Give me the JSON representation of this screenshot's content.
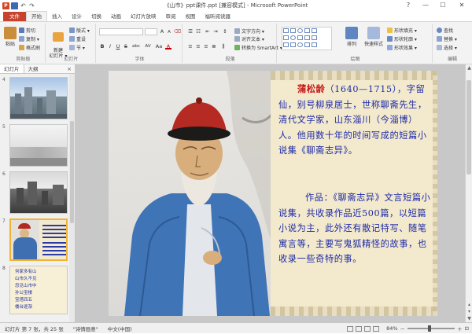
{
  "window": {
    "title": "《山市》ppt课件.ppt [兼容模式] - Microsoft PowerPoint",
    "app_icon_letter": "P"
  },
  "ribbon_tabs": [
    "文件",
    "开始",
    "插入",
    "设计",
    "切换",
    "动画",
    "幻灯片放映",
    "审阅",
    "视图",
    "福昕阅读器"
  ],
  "ribbon": {
    "clipboard": {
      "paste": "粘贴",
      "cut": "剪切",
      "copy": "复制 ▾",
      "format_painter": "格式刷",
      "label": "剪贴板"
    },
    "slides": {
      "new_slide": "新建\n幻灯片 ▾",
      "layout": "版式 ▾",
      "reset": "重设",
      "section": "节 ▾",
      "label": "幻灯片"
    },
    "font": {
      "label": "字体",
      "bold": "B",
      "italic": "I",
      "underline": "U",
      "strike": "S",
      "shadow": "abc",
      "spacing": "AV",
      "case": "Aa",
      "color": "A",
      "grow": "A",
      "shrink": "A"
    },
    "paragraph": {
      "label": "段落",
      "text_direction": "文字方向 ▾",
      "align_text": "对齐文本 ▾",
      "smartart": "转换为 SmartArt ▾"
    },
    "drawing": {
      "label": "绘图",
      "arrange": "排列",
      "quick_styles": "快速样式",
      "shape_fill": "形状填充 ▾",
      "shape_outline": "形状轮廓 ▾",
      "shape_effects": "形状效果 ▾"
    },
    "editing": {
      "label": "编辑",
      "find": "查找",
      "replace": "替换 ▾",
      "select": "选择 ▾"
    }
  },
  "left_pane": {
    "tabs": [
      "幻灯片",
      "大纲"
    ],
    "close": "×",
    "thumbnails": [
      {
        "num": "4",
        "kind": "city"
      },
      {
        "num": "5",
        "kind": "mist"
      },
      {
        "num": "6",
        "kind": "bw-city"
      },
      {
        "num": "7",
        "kind": "portrait",
        "selected": true
      },
      {
        "num": "8",
        "kind": "text-list",
        "lines": [
          "何家多有山",
          "山市久不见",
          "忽见山市中",
          "孙公宝楼",
          "宝塔四五",
          "楼台逐渐"
        ]
      }
    ]
  },
  "slide": {
    "paragraph1": {
      "name": "蒲松龄",
      "rest": "（1640—1715），字留仙，别号柳泉居士，世称聊斋先生，清代文学家，山东淄川（今淄博）人。他用数十年的时间写成的短篇小说集《聊斋志异》。"
    },
    "paragraph2": "作品：《聊斋志异》文言短篇小说集，共收录作品近500篇，以短篇小说为主，此外还有散记特写、随笔寓言等，主要写鬼狐精怪的故事，也收录一些奇特的事。"
  },
  "statusbar": {
    "slide_info": "幻灯片 第 7 张，共 25 张",
    "theme": "\"诗情画意\"",
    "language": "中文(中国)",
    "zoom": "84%"
  },
  "colors": {
    "file_tab": "#c6442e",
    "title_name": "#c41a1a",
    "body_text": "#1c2aa8",
    "selected_thumb": "#f2b233"
  }
}
